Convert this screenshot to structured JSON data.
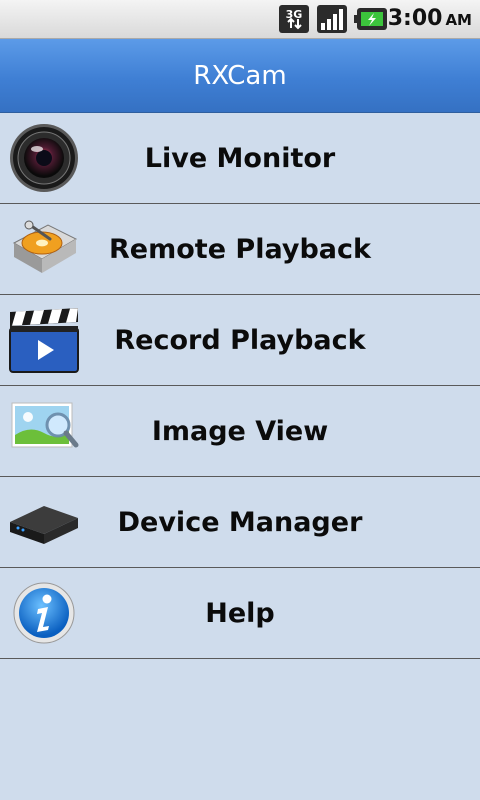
{
  "status_bar": {
    "network": "3G",
    "time": "3:00",
    "ampm": "AM",
    "icons": [
      "network-3g-icon",
      "signal-icon",
      "battery-charging-icon"
    ]
  },
  "app": {
    "title": "RXCam"
  },
  "menu": {
    "items": [
      {
        "label": "Live Monitor",
        "icon": "camera-lens-icon"
      },
      {
        "label": "Remote Playback",
        "icon": "hard-drive-icon"
      },
      {
        "label": "Record Playback",
        "icon": "clapperboard-icon"
      },
      {
        "label": "Image View",
        "icon": "image-magnifier-icon"
      },
      {
        "label": "Device Manager",
        "icon": "dvr-box-icon"
      },
      {
        "label": "Help",
        "icon": "info-icon"
      }
    ]
  },
  "colors": {
    "background": "#cfdcec",
    "titlebar": "#3f7fd4",
    "divider": "#5a5a5a"
  }
}
